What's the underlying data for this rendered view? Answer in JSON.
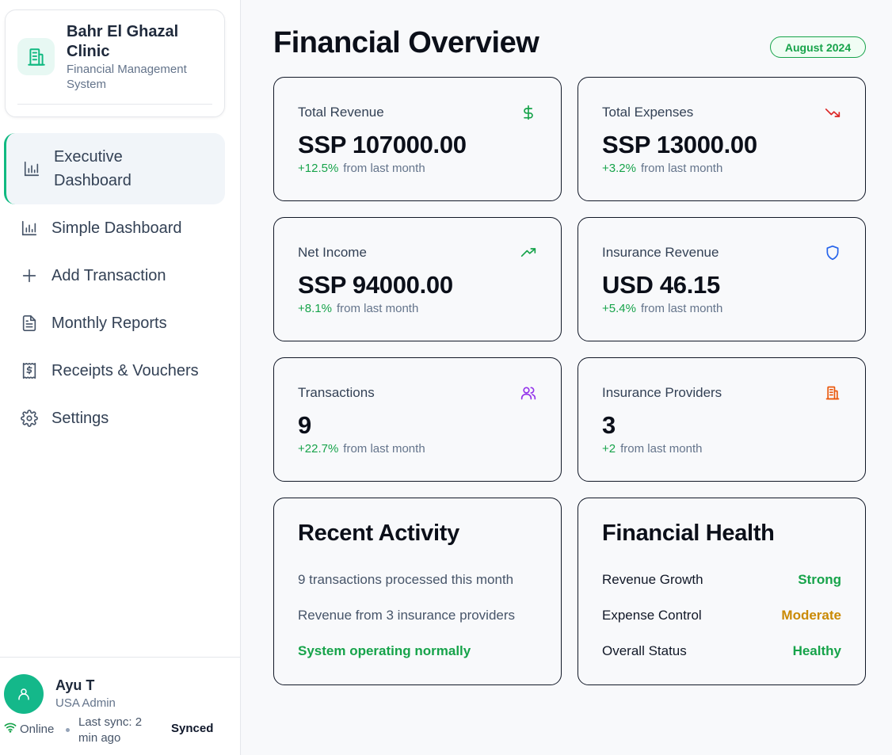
{
  "brand": {
    "name": "Bahr El Ghazal Clinic",
    "subtitle": "Financial Management System"
  },
  "nav": [
    {
      "label": "Executive Dashboard",
      "icon": "bar-chart-icon",
      "active": true
    },
    {
      "label": "Simple Dashboard",
      "icon": "bar-chart-icon",
      "active": false
    },
    {
      "label": "Add Transaction",
      "icon": "plus-icon",
      "active": false
    },
    {
      "label": "Monthly Reports",
      "icon": "document-icon",
      "active": false
    },
    {
      "label": "Receipts & Vouchers",
      "icon": "receipt-icon",
      "active": false
    },
    {
      "label": "Settings",
      "icon": "gear-icon",
      "active": false
    }
  ],
  "user": {
    "name": "Ayu T",
    "role": "USA Admin",
    "connection": "Online",
    "last_sync": "Last sync: 2 min ago",
    "sync_status": "Synced"
  },
  "header": {
    "title": "Financial Overview",
    "period": "August 2024"
  },
  "stats": [
    {
      "title": "Total Revenue",
      "value": "SSP 107000.00",
      "change": "+12.5%",
      "note": "from last month",
      "icon": "dollar-icon",
      "icon_color": "#16a34a"
    },
    {
      "title": "Total Expenses",
      "value": "SSP 13000.00",
      "change": "+3.2%",
      "note": "from last month",
      "icon": "trending-down-icon",
      "icon_color": "#dc2626"
    },
    {
      "title": "Net Income",
      "value": "SSP 94000.00",
      "change": "+8.1%",
      "note": "from last month",
      "icon": "trending-up-icon",
      "icon_color": "#16a34a"
    },
    {
      "title": "Insurance Revenue",
      "value": "USD 46.15",
      "change": "+5.4%",
      "note": "from last month",
      "icon": "shield-icon",
      "icon_color": "#2563eb"
    },
    {
      "title": "Transactions",
      "value": "9",
      "change": "+22.7%",
      "note": "from last month",
      "icon": "users-icon",
      "icon_color": "#9333ea"
    },
    {
      "title": "Insurance Providers",
      "value": "3",
      "change": "+2",
      "note": "from last month",
      "icon": "building-icon",
      "icon_color": "#ea580c"
    }
  ],
  "activity": {
    "title": "Recent Activity",
    "lines": [
      "9 transactions processed this month",
      "Revenue from 3 insurance providers"
    ],
    "status": "System operating normally"
  },
  "health": {
    "title": "Financial Health",
    "rows": [
      {
        "label": "Revenue Growth",
        "value": "Strong",
        "color": "#16a34a"
      },
      {
        "label": "Expense Control",
        "value": "Moderate",
        "color": "#ca8a04"
      },
      {
        "label": "Overall Status",
        "value": "Healthy",
        "color": "#16a34a"
      }
    ]
  }
}
